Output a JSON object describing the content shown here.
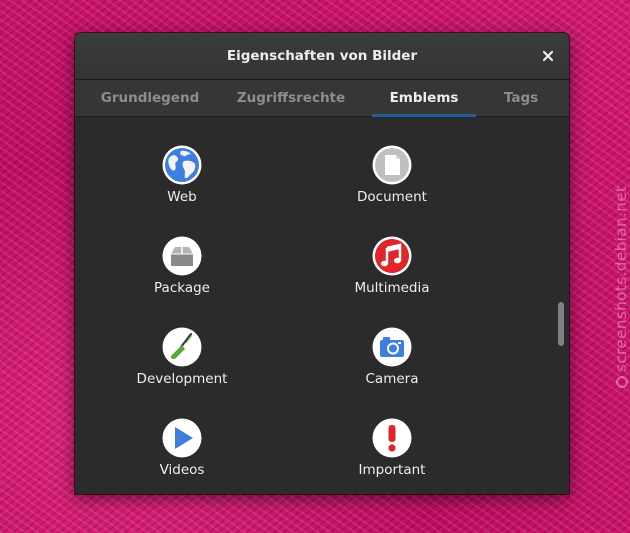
{
  "watermark": "screenshots.debian.net",
  "dialog": {
    "title": "Eigenschaften von Bilder",
    "close_icon": "close-icon"
  },
  "tabs": [
    {
      "label": "Grundlegend",
      "active": false
    },
    {
      "label": "Zugriffsrechte",
      "active": false
    },
    {
      "label": "Emblems",
      "active": true
    },
    {
      "label": "Tags",
      "active": false
    }
  ],
  "emblems": [
    {
      "label": "Web",
      "icon": "globe-icon"
    },
    {
      "label": "Document",
      "icon": "document-icon"
    },
    {
      "label": "Package",
      "icon": "package-icon"
    },
    {
      "label": "Multimedia",
      "icon": "music-note-icon"
    },
    {
      "label": "Development",
      "icon": "trowel-icon"
    },
    {
      "label": "Camera",
      "icon": "camera-icon"
    },
    {
      "label": "Videos",
      "icon": "play-icon"
    },
    {
      "label": "Important",
      "icon": "exclamation-icon"
    }
  ],
  "colors": {
    "accent": "#215d9c",
    "background": "#d4126e"
  }
}
